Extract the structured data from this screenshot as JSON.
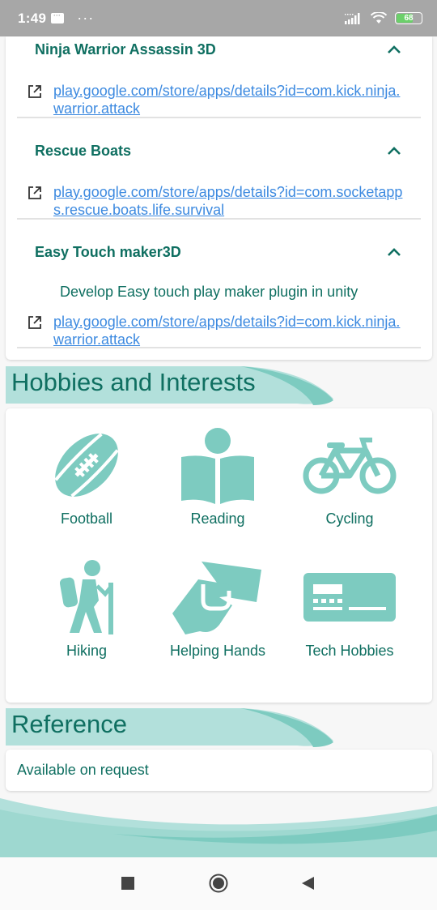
{
  "status_bar": {
    "time": "1:49",
    "dots": "···",
    "battery_level": "68",
    "battery_fraction": 0.68
  },
  "projects": [
    {
      "title": "Ninja Warrior Assassin 3D",
      "description": "",
      "link": "play.google.com/store/apps/details?id=com.kick.ninja.warrior.attack"
    },
    {
      "title": "Rescue Boats",
      "description": "",
      "link": "play.google.com/store/apps/details?id=com.socketapps.rescue.boats.life.survival"
    },
    {
      "title": "Easy Touch maker3D",
      "description": "Develop Easy touch play maker plugin in unity",
      "link": "play.google.com/store/apps/details?id=com.kick.ninja.warrior.attack"
    }
  ],
  "hobbies_section": {
    "title": "Hobbies and Interests",
    "items": [
      {
        "label": "Football",
        "icon": "football-icon"
      },
      {
        "label": "Reading",
        "icon": "reading-icon"
      },
      {
        "label": "Cycling",
        "icon": "bicycle-icon"
      },
      {
        "label": "Hiking",
        "icon": "hiking-icon"
      },
      {
        "label": "Helping Hands",
        "icon": "handshake-icon"
      },
      {
        "label": "Tech Hobbies",
        "icon": "keyboard-icon"
      }
    ]
  },
  "reference_section": {
    "title": "Reference",
    "text": "Available on request"
  },
  "colors": {
    "accent": "#0f6f61",
    "icon_teal": "#7dcbc0",
    "link": "#3d8ae0",
    "wave": "#b2e0db"
  }
}
